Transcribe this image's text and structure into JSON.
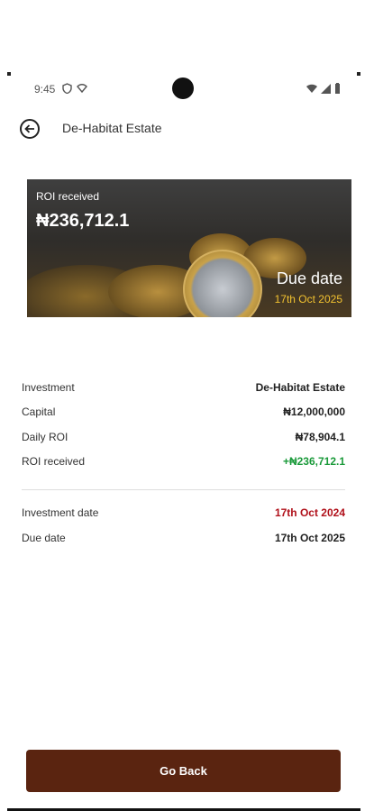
{
  "status_bar": {
    "time": "9:45"
  },
  "header": {
    "title": "De-Habitat Estate"
  },
  "banner": {
    "roi_label": "ROI received",
    "roi_value": "₦236,712.1",
    "due_label": "Due date",
    "due_value": "17th Oct 2025"
  },
  "details": [
    {
      "label": "Investment",
      "value": "De-Habitat Estate"
    },
    {
      "label": "Capital",
      "value": "₦12,000,000"
    },
    {
      "label": "Daily ROI",
      "value": "₦78,904.1"
    },
    {
      "label": "ROI received",
      "value": "+₦236,712.1"
    }
  ],
  "dates": [
    {
      "label": "Investment date",
      "value": "17th Oct 2024"
    },
    {
      "label": "Due date",
      "value": "17th Oct 2025"
    }
  ],
  "colors": {
    "primary": "#5a2410",
    "positive": "#1a9a3a",
    "negative": "#b0101a",
    "banner_accent": "#f2c230"
  },
  "go_back_label": "Go Back"
}
